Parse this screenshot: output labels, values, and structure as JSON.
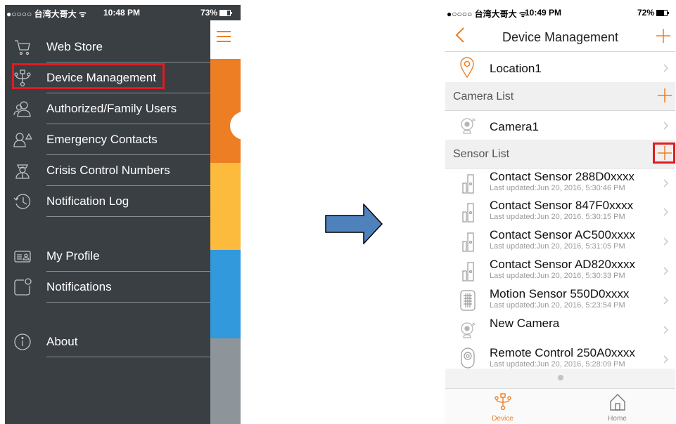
{
  "left": {
    "status": {
      "carrier": "●○○○○ 台湾大哥大 ᯤ",
      "time": "10:48 PM",
      "battery": "73%"
    },
    "menu": [
      {
        "label": "Web Store",
        "icon": "cart-icon"
      },
      {
        "label": "Device Management",
        "icon": "device-tree-icon"
      },
      {
        "label": "Authorized/Family Users",
        "icon": "users-icon"
      },
      {
        "label": "Emergency Contacts",
        "icon": "emergency-contact-icon"
      },
      {
        "label": "Crisis Control Numbers",
        "icon": "officer-icon"
      },
      {
        "label": "Notification Log",
        "icon": "history-clock-icon"
      },
      {
        "label": "My Profile",
        "icon": "id-card-icon"
      },
      {
        "label": "Notifications",
        "icon": "notification-badge-icon"
      },
      {
        "label": "About",
        "icon": "info-icon"
      }
    ]
  },
  "right": {
    "status": {
      "carrier": "●○○○○ 台湾大哥大 ᯤ",
      "time": "10:49 PM",
      "battery": "72%"
    },
    "nav": {
      "title": "Device Management"
    },
    "location": {
      "label": "Location1"
    },
    "camera_section": {
      "label": "Camera List"
    },
    "camera": {
      "label": "Camera1"
    },
    "sensor_section": {
      "label": "Sensor List"
    },
    "sensors": [
      {
        "name": "Contact Sensor 288D0xxxx",
        "updated": "Last updated:Jun 20, 2016, 5:30:46 PM",
        "icon": "contact-sensor-icon"
      },
      {
        "name": "Contact Sensor 847F0xxxx",
        "updated": "Last updated:Jun 20, 2016, 5:30:15 PM",
        "icon": "contact-sensor-icon"
      },
      {
        "name": "Contact Sensor AC500xxxx",
        "updated": "Last updated:Jun 20, 2016, 5:31:05 PM",
        "icon": "contact-sensor-icon"
      },
      {
        "name": "Contact Sensor AD820xxxx",
        "updated": "Last updated:Jun 20, 2016, 5:30:33 PM",
        "icon": "contact-sensor-icon"
      },
      {
        "name": "Motion Sensor 550D0xxxx",
        "updated": "Last updated:Jun 20, 2016, 5:23:54 PM",
        "icon": "motion-sensor-icon"
      },
      {
        "name": "New Camera",
        "updated": "",
        "icon": "camera-icon"
      },
      {
        "name": "Remote Control 250A0xxxx",
        "updated": "Last updated:Jun 20, 2016, 5:28:09 PM",
        "icon": "remote-control-icon"
      }
    ],
    "tabs": [
      {
        "label": "Device",
        "icon": "device-tree-icon",
        "color": "#ee7e23"
      },
      {
        "label": "Home",
        "icon": "home-icon",
        "color": "#888888"
      }
    ]
  },
  "colors": {
    "accent": "#ee7e23",
    "highlight": "#e11b22",
    "drawer": "#3a3f44",
    "arrow": "#4f81bd"
  }
}
